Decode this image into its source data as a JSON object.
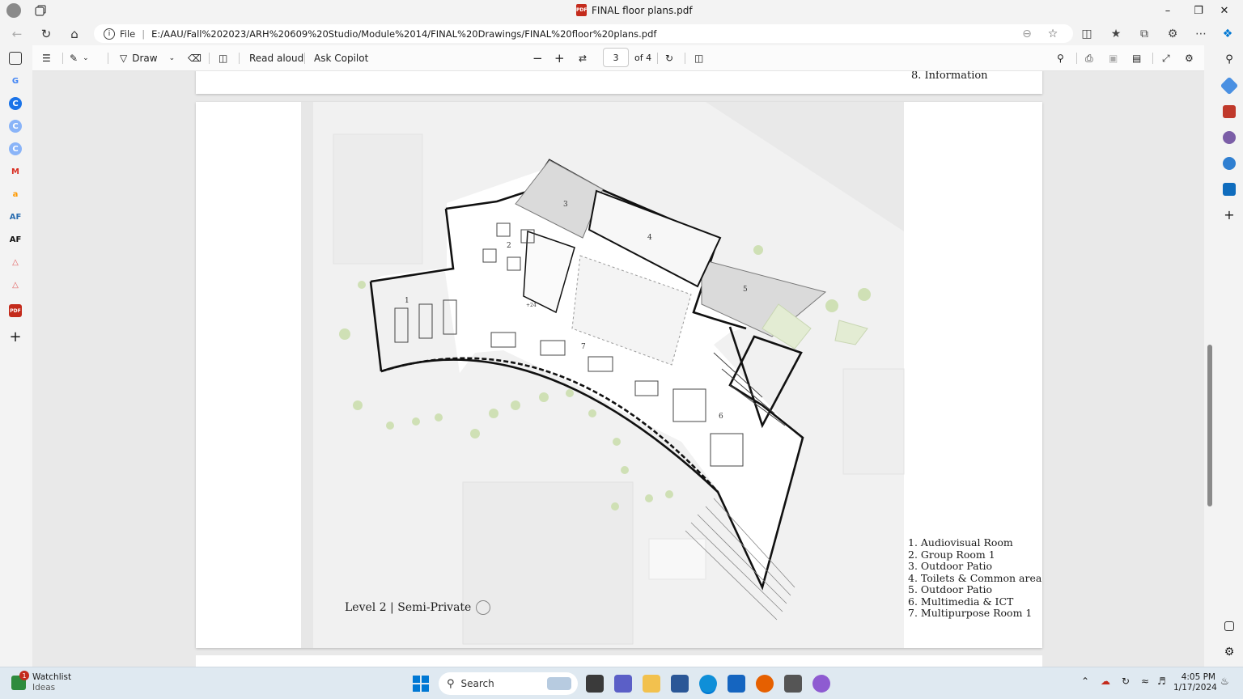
{
  "window": {
    "title": "FINAL floor plans.pdf"
  },
  "address_bar": {
    "scheme_label": "File",
    "url": "E:/AAU/Fall%202023/ARH%20609%20Studio/Module%2014/FINAL%20Drawings/FINAL%20floor%20plans.pdf"
  },
  "pdf_toolbar": {
    "draw_label": "Draw",
    "read_aloud_label": "Read aloud",
    "ask_copilot_label": "Ask Copilot",
    "page_number": "3",
    "page_total": "of 4"
  },
  "document": {
    "prev_page_item": "8.  Information",
    "plan_caption": "Level 2 | Semi-Private",
    "room_numbers": [
      "1",
      "2",
      "3",
      "4",
      "5",
      "6",
      "7"
    ],
    "level_mark": "+24",
    "legend": [
      "1.  Audiovisual Room",
      "2.  Group Room 1",
      "3.  Outdoor Patio",
      "4.  Toilets & Common area",
      "5.  Outdoor Patio",
      "6.  Multimedia & ICT",
      "7.  Multipurpose Room 1"
    ]
  },
  "taskbar": {
    "widget_title": "Watchlist",
    "widget_subtitle": "Ideas",
    "widget_badge": "1",
    "search_label": "Search",
    "time": "4:05 PM",
    "date": "1/17/2024"
  },
  "colors": {
    "pdf_red": "#c42b1c",
    "edge_blue": "#0078d4",
    "taskbar_bg": "#dfe9f1"
  }
}
